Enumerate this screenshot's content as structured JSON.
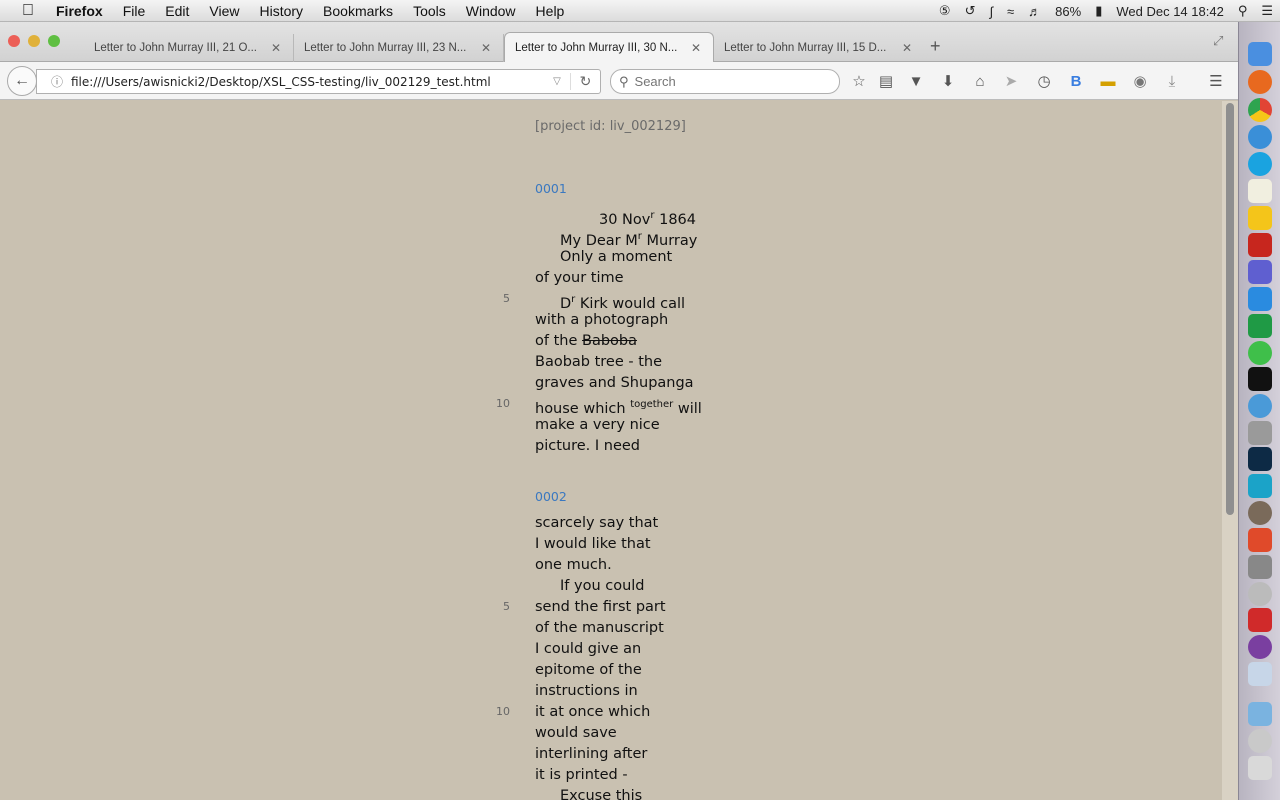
{
  "menubar": {
    "app": "Firefox",
    "items": [
      "File",
      "Edit",
      "View",
      "History",
      "Bookmarks",
      "Tools",
      "Window",
      "Help"
    ],
    "battery": "86%",
    "clock": "Wed Dec 14  18:42"
  },
  "tabs": [
    {
      "label": "Letter to John Murray III, 21 O..."
    },
    {
      "label": "Letter to John Murray III, 23 N..."
    },
    {
      "label": "Letter to John Murray III, 30 N..."
    },
    {
      "label": "Letter to John Murray III, 15 D..."
    }
  ],
  "toolbar": {
    "url": "file:///Users/awisnicki2/Desktop/XSL_CSS-testing/liv_002129_test.html",
    "search_placeholder": "Search"
  },
  "document": {
    "project_id": "[project id: liv_002129]",
    "pages": [
      {
        "number": "0001",
        "lines": [
          "30 Novʳ 1864",
          "My Dear Mʳ Murray",
          "Only a moment",
          "of your time",
          "Dʳ Kirk would call",
          "with a photograph",
          "of the Baboba",
          "Baobab tree - the",
          "graves and Shupanga",
          "house which together will",
          "make a very nice",
          "picture. I need"
        ],
        "line_numbers": [
          "5",
          "10"
        ]
      },
      {
        "number": "0002",
        "lines": [
          "scarcely say that",
          "I would like that",
          "one much.",
          "If you could",
          "send the first part",
          "of the manuscript",
          "I could give an",
          "epitome of the",
          "instructions in",
          "it at once which",
          "would save",
          "interlining after",
          "it is printed -",
          "Excuse this"
        ],
        "line_numbers": [
          "5",
          "10"
        ]
      }
    ]
  },
  "line_parts": {
    "p1l1a": "30 Nov",
    "p1l1sup": "r",
    "p1l1b": " 1864",
    "p1l2a": "My Dear M",
    "p1l2sup": "r",
    "p1l2b": " Murray",
    "p1l5a": "D",
    "p1l5sup": "r",
    "p1l5b": " Kirk would call",
    "p1l7a": "of the ",
    "p1l7del": "Baboba",
    "p1l10a": "house which ",
    "p1l10sup": "together",
    "p1l10b": " will"
  }
}
